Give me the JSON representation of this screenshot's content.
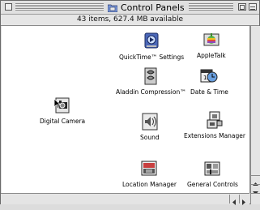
{
  "window": {
    "title": "Control Panels",
    "info": "43 items, 627.4 MB available"
  },
  "items": [
    {
      "name": "qt",
      "label": "QuickTime™ Settings",
      "icon": "quicktime-icon"
    },
    {
      "name": "appletalk",
      "label": "AppleTalk",
      "icon": "appletalk-icon"
    },
    {
      "name": "aladdin",
      "label": "Aladdin Compression™",
      "icon": "aladdin-icon"
    },
    {
      "name": "datetime",
      "label": "Date & Time",
      "icon": "date-time-icon"
    },
    {
      "name": "camera",
      "label": "Digital Camera",
      "icon": "digital-camera-icon"
    },
    {
      "name": "sound",
      "label": "Sound",
      "icon": "sound-icon"
    },
    {
      "name": "extensions",
      "label": "Extensions Manager",
      "icon": "extensions-manager-icon"
    },
    {
      "name": "location",
      "label": "Location Manager",
      "icon": "location-manager-icon"
    },
    {
      "name": "general",
      "label": "General Controls",
      "icon": "general-controls-icon"
    }
  ],
  "colors": {
    "window_bg": "#dedede",
    "content_bg": "#ffffff",
    "accent": "#5b7fd0"
  }
}
